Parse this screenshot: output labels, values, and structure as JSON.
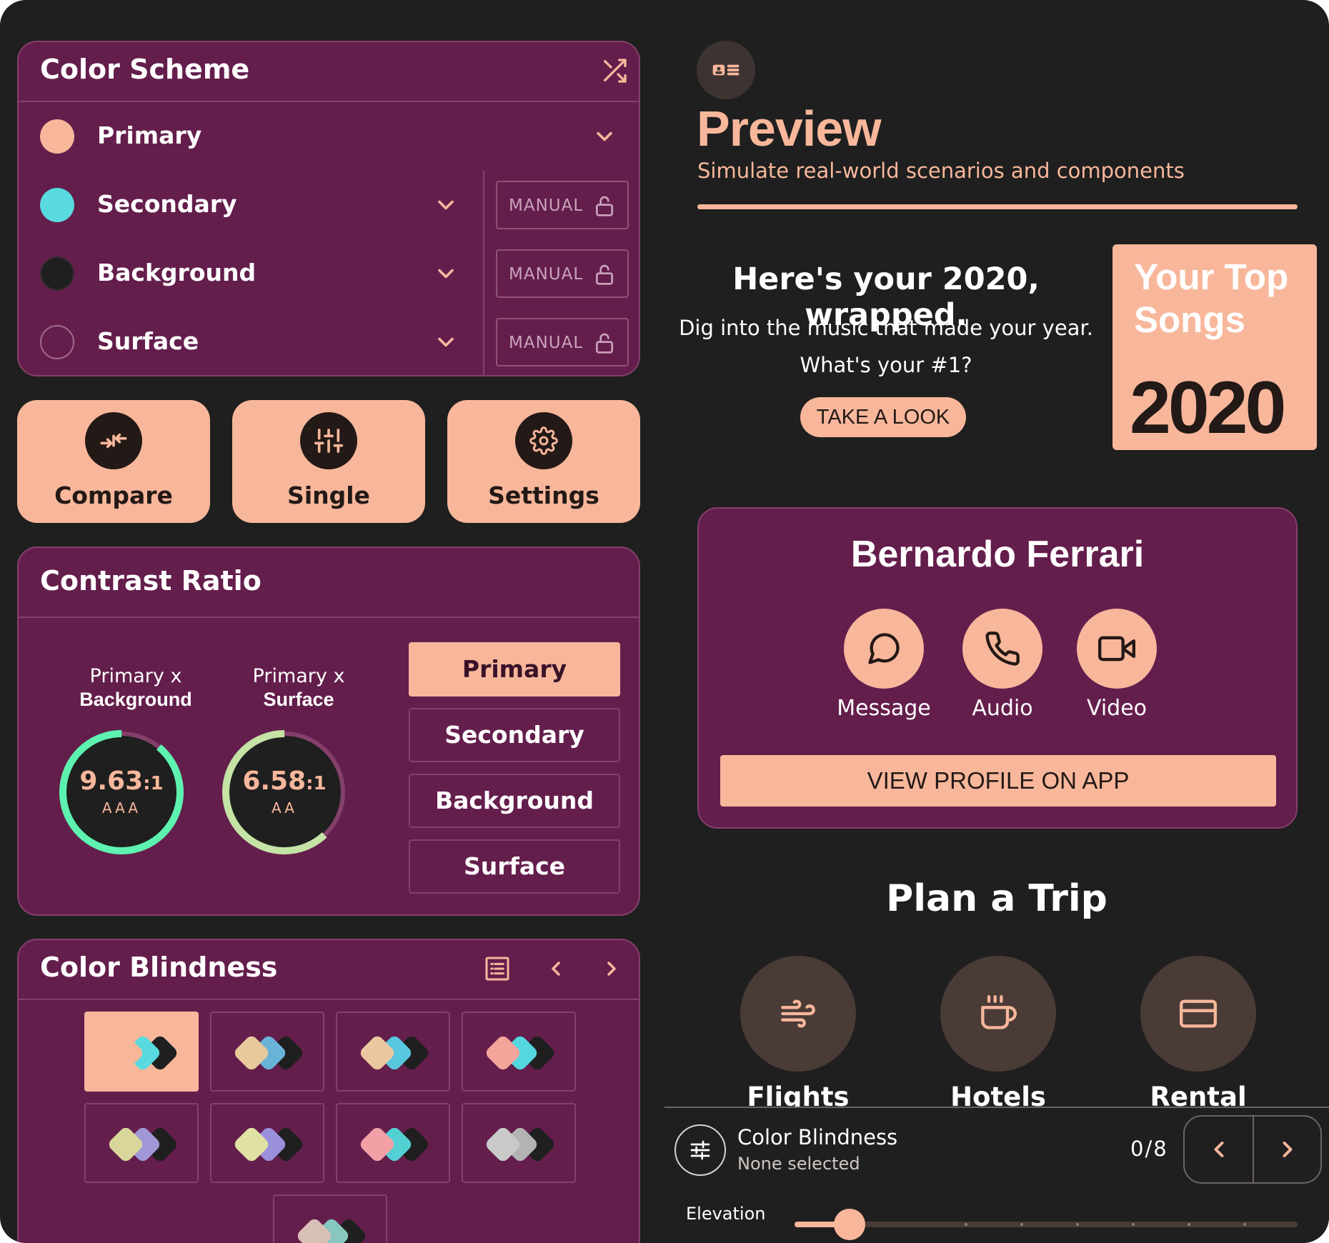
{
  "color_scheme": {
    "title": "Color Scheme",
    "shuffle_icon": "shuffle-icon",
    "rows": [
      {
        "label": "Primary",
        "color": "#f8b79b"
      },
      {
        "label": "Secondary",
        "color": "#59dade",
        "mode": "MANUAL"
      },
      {
        "label": "Background",
        "color": "#1f1f1f",
        "mode": "MANUAL"
      },
      {
        "label": "Surface",
        "color": "#641e4c",
        "mode": "MANUAL"
      }
    ]
  },
  "actions": [
    {
      "label": "Compare",
      "icon": "compare-arrows-icon"
    },
    {
      "label": "Single",
      "icon": "sliders-icon"
    },
    {
      "label": "Settings",
      "icon": "gear-icon"
    }
  ],
  "contrast": {
    "title": "Contrast Ratio",
    "gauges": [
      {
        "line1": "Primary x",
        "line2": "Background",
        "ratio": "9.63",
        "suffix": ":1",
        "grade": "AAA",
        "fill": 0.89,
        "color": "#5ef2b0"
      },
      {
        "line1": "Primary x",
        "line2": "Surface",
        "ratio": "6.58",
        "suffix": ":1",
        "grade": "AA",
        "fill": 0.62,
        "color": "#c4e3a5"
      }
    ],
    "tabs": [
      "Primary",
      "Secondary",
      "Background",
      "Surface"
    ],
    "active_tab": "Primary"
  },
  "color_blindness": {
    "title": "Color Blindness",
    "list_icon": "list-view-icon",
    "prev_icon": "chevron-left-icon",
    "next_icon": "chevron-right-icon",
    "tiles": [
      [
        "#f8b79b",
        "#59dade",
        "#1f1f1f"
      ],
      [
        "#e8c99b",
        "#6ab3d8",
        "#1f1f1f"
      ],
      [
        "#ebc7a0",
        "#59c8de",
        "#1f1f1f"
      ],
      [
        "#f3a49b",
        "#54d7de",
        "#1f1f1f"
      ],
      [
        "#d8d69a",
        "#9f97d6",
        "#1f1f1f"
      ],
      [
        "#e0e2a4",
        "#9a8fda",
        "#1f1f1f"
      ],
      [
        "#f1a0a6",
        "#53d0d4",
        "#1f1f1f"
      ],
      [
        "#c9c9c9",
        "#b3b3b3",
        "#1f1f1f"
      ],
      [
        "#d9c0b7",
        "#88c6c0",
        "#1f1f1f"
      ]
    ]
  },
  "preview": {
    "icon": "id-card-icon",
    "title": "Preview",
    "subtitle": "Simulate real-world scenarios and components"
  },
  "wrapped": {
    "title": "Here's your 2020, wrapped.",
    "line1": "Dig into the music that made your year.",
    "line2": "What's your #1?",
    "button": "TAKE A LOOK",
    "card_title": "Your Top Songs",
    "card_year": "2020"
  },
  "profile": {
    "name": "Bernardo Ferrari",
    "actions": [
      {
        "label": "Message",
        "icon": "chat-bubble-icon"
      },
      {
        "label": "Audio",
        "icon": "phone-icon"
      },
      {
        "label": "Video",
        "icon": "video-camera-icon"
      }
    ],
    "button": "VIEW PROFILE ON APP"
  },
  "trip": {
    "title": "Plan a Trip",
    "items": [
      {
        "label": "Flights",
        "icon": "wind-icon"
      },
      {
        "label": "Hotels",
        "icon": "coffee-cup-icon"
      },
      {
        "label": "Rental",
        "icon": "credit-card-icon"
      }
    ]
  },
  "bottom_panel": {
    "icon": "tune-icon",
    "title": "Color Blindness",
    "subtitle": "None selected",
    "count": "0/8",
    "elevation_label": "Elevation",
    "elevation_value": 0.11
  }
}
